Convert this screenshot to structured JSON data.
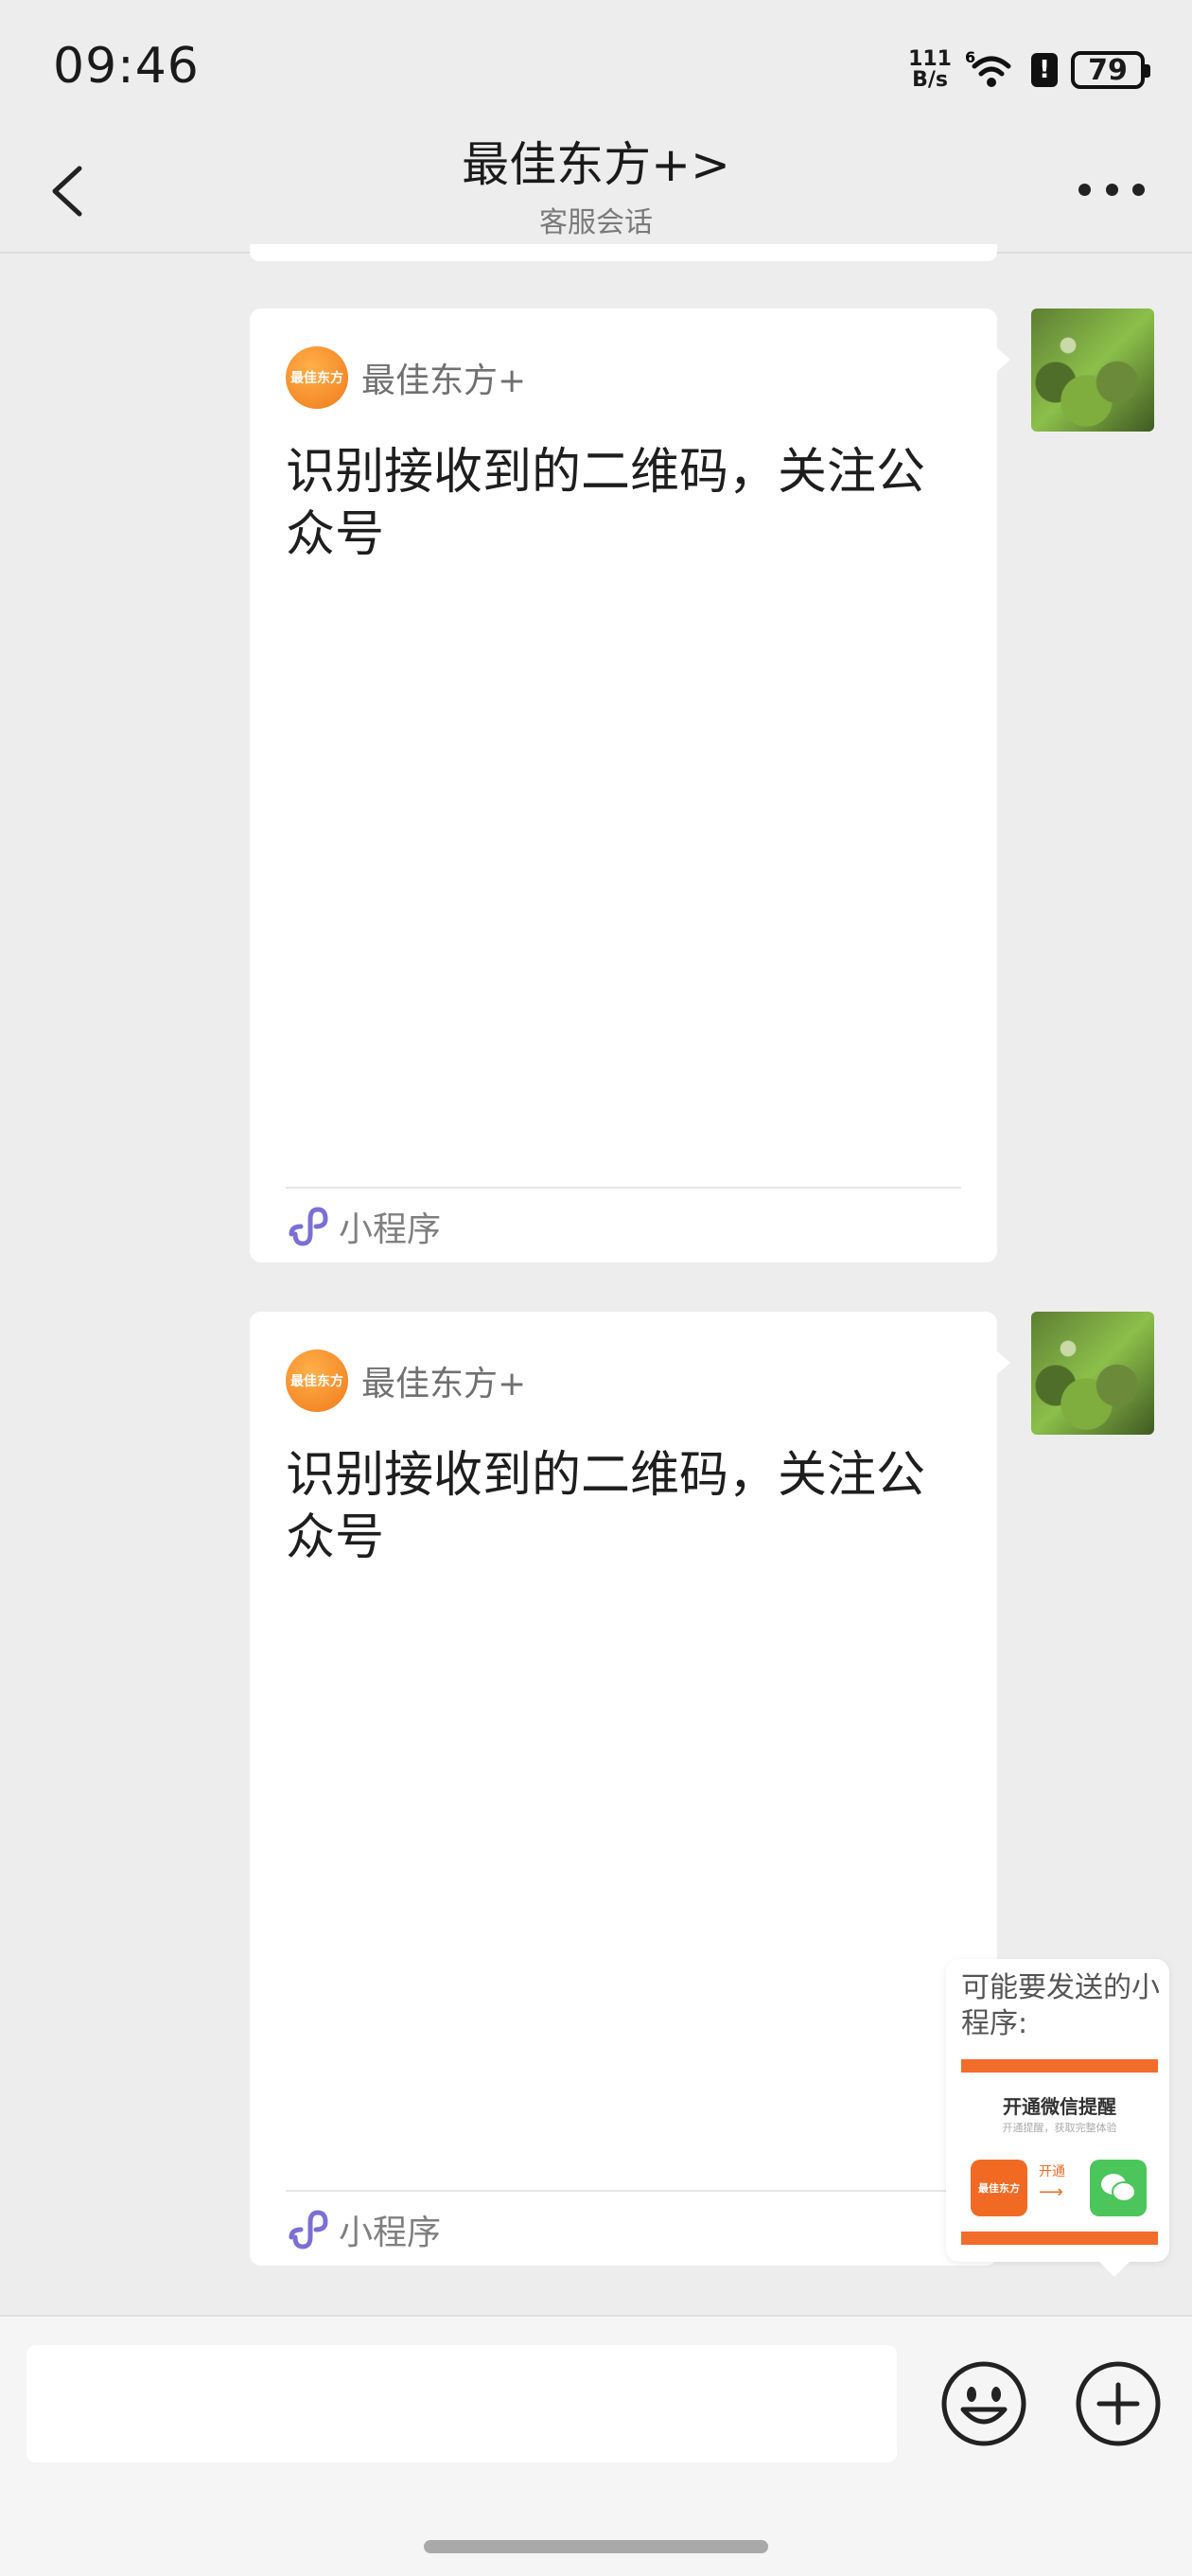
{
  "status_bar": {
    "time": "09:46",
    "net_speed_value": "111",
    "net_speed_unit": "B/s",
    "signal_label": "6",
    "battery": "79"
  },
  "nav": {
    "title": "最佳东方+",
    "title_chevron": ">",
    "subtitle": "客服会话"
  },
  "messages": [
    {
      "brand_logo_text": "最佳东方",
      "brand_name": "最佳东方+",
      "text": "识别接收到的二维码，关注公众号",
      "footer_label": "小程序"
    },
    {
      "brand_logo_text": "最佳东方",
      "brand_name": "最佳东方+",
      "text": "识别接收到的二维码，关注公众号",
      "footer_label": "小程序"
    }
  ],
  "suggestion": {
    "title": "可能要发送的小程序:",
    "preview_heading": "开通微信提醒",
    "preview_sub": "开通提醒，获取完整体验",
    "preview_logo_text": "最佳东方",
    "preview_open_label": "开通",
    "preview_arrow": "⟶"
  },
  "input": {
    "placeholder": ""
  },
  "colors": {
    "brand_orange": "#f07a1a",
    "wechat_green": "#4cc55a",
    "background": "#ededed"
  }
}
